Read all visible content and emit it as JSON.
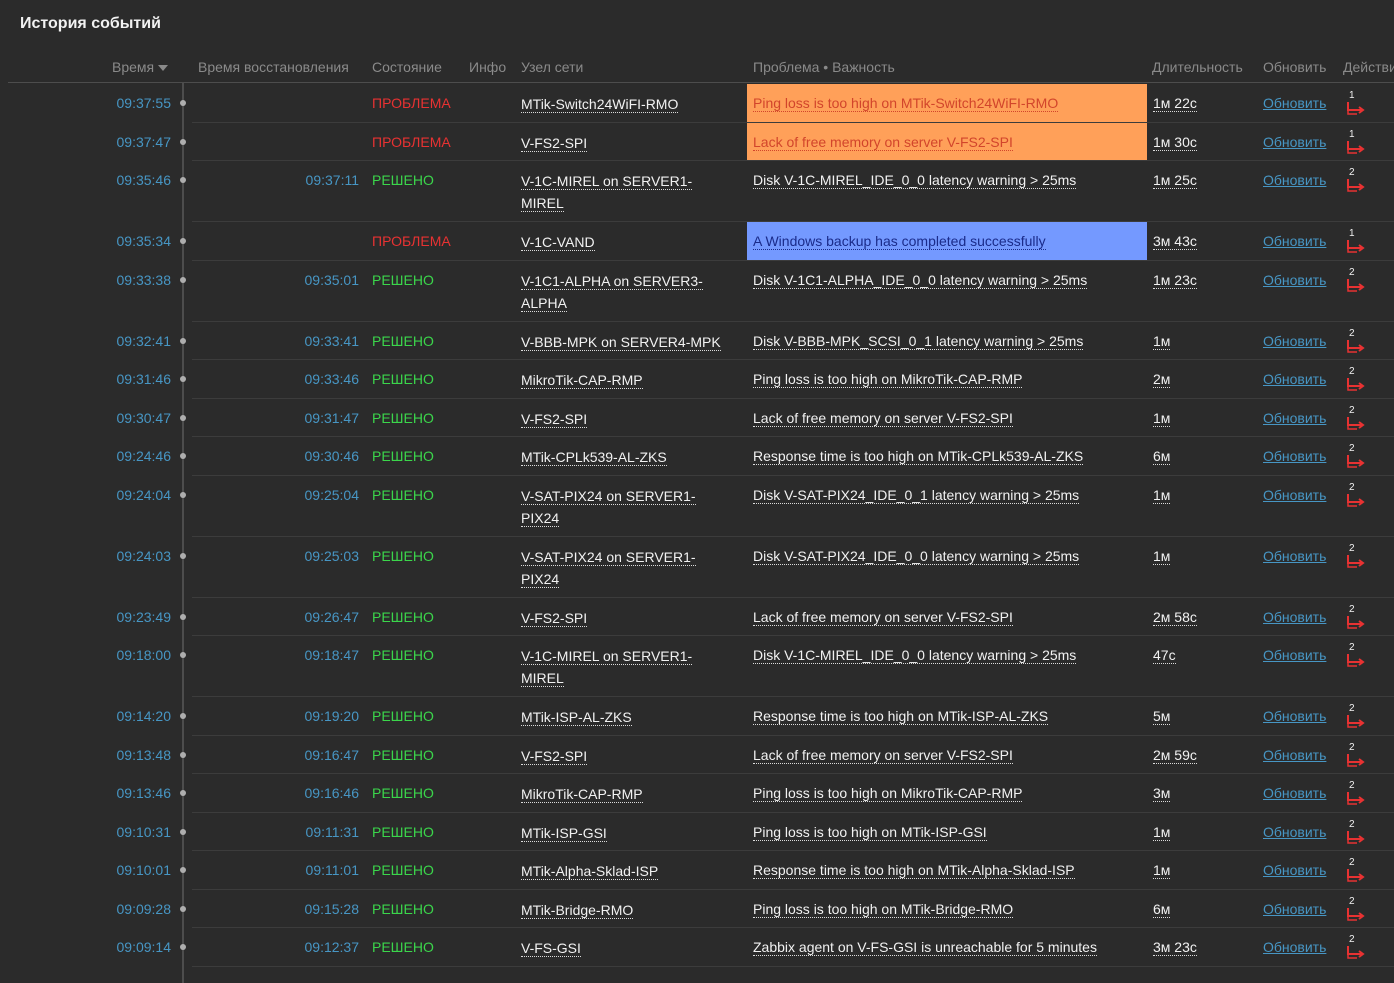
{
  "widget": {
    "title": "История событий"
  },
  "headers": {
    "time": "Время",
    "recovery": "Время восстановления",
    "status": "Состояние",
    "info": "Инфо",
    "host": "Узел сети",
    "problem": "Проблема • Важность",
    "duration": "Длительность",
    "ack": "Обновить",
    "actions": "Действия"
  },
  "rows": [
    {
      "time": "09:37:55",
      "recovery": "",
      "status": "ПРОБЛЕМА",
      "host": "MTik-Switch24WiFI-RMO",
      "problem": "Ping loss is too high on MTik-Switch24WiFI-RMO",
      "duration": "1м 22с",
      "ack": "Обновить",
      "actions": "1"
    },
    {
      "time": "09:37:47",
      "recovery": "",
      "status": "ПРОБЛЕМА",
      "host": "V-FS2-SPI",
      "problem": "Lack of free memory on server V-FS2-SPI",
      "duration": "1м 30с",
      "ack": "Обновить",
      "actions": "1"
    },
    {
      "time": "09:35:46",
      "recovery": "09:37:11",
      "status": "РЕШЕНО",
      "host": "V-1C-MIREL on SERVER1-MIREL",
      "problem": "Disk V-1C-MIREL_IDE_0_0 latency warning > 25ms",
      "duration": "1м 25с",
      "ack": "Обновить",
      "actions": "2"
    },
    {
      "time": "09:35:34",
      "recovery": "",
      "status": "ПРОБЛЕМА",
      "host": "V-1C-VAND",
      "problem": "A Windows backup has completed successfully",
      "duration": "3м 43с",
      "ack": "Обновить",
      "actions": "1"
    },
    {
      "time": "09:33:38",
      "recovery": "09:35:01",
      "status": "РЕШЕНО",
      "host": "V-1C1-ALPHA on SERVER3-ALPHA",
      "problem": "Disk V-1C1-ALPHA_IDE_0_0 latency warning > 25ms",
      "duration": "1м 23с",
      "ack": "Обновить",
      "actions": "2"
    },
    {
      "time": "09:32:41",
      "recovery": "09:33:41",
      "status": "РЕШЕНО",
      "host": "V-BBB-MPK on SERVER4-MPK",
      "problem": "Disk V-BBB-MPK_SCSI_0_1 latency warning > 25ms",
      "duration": "1м",
      "ack": "Обновить",
      "actions": "2"
    },
    {
      "time": "09:31:46",
      "recovery": "09:33:46",
      "status": "РЕШЕНО",
      "host": "MikroTik-CAP-RMP",
      "problem": "Ping loss is too high on MikroTik-CAP-RMP",
      "duration": "2м",
      "ack": "Обновить",
      "actions": "2"
    },
    {
      "time": "09:30:47",
      "recovery": "09:31:47",
      "status": "РЕШЕНО",
      "host": "V-FS2-SPI",
      "problem": "Lack of free memory on server V-FS2-SPI",
      "duration": "1м",
      "ack": "Обновить",
      "actions": "2"
    },
    {
      "time": "09:24:46",
      "recovery": "09:30:46",
      "status": "РЕШЕНО",
      "host": "MTik-CPLk539-AL-ZKS",
      "problem": "Response time is too high on MTik-CPLk539-AL-ZKS",
      "duration": "6м",
      "ack": "Обновить",
      "actions": "2"
    },
    {
      "time": "09:24:04",
      "recovery": "09:25:04",
      "status": "РЕШЕНО",
      "host": "V-SAT-PIX24 on SERVER1-PIX24",
      "problem": "Disk V-SAT-PIX24_IDE_0_1 latency warning > 25ms",
      "duration": "1м",
      "ack": "Обновить",
      "actions": "2"
    },
    {
      "time": "09:24:03",
      "recovery": "09:25:03",
      "status": "РЕШЕНО",
      "host": "V-SAT-PIX24 on SERVER1-PIX24",
      "problem": "Disk V-SAT-PIX24_IDE_0_0 latency warning > 25ms",
      "duration": "1м",
      "ack": "Обновить",
      "actions": "2"
    },
    {
      "time": "09:23:49",
      "recovery": "09:26:47",
      "status": "РЕШЕНО",
      "host": "V-FS2-SPI",
      "problem": "Lack of free memory on server V-FS2-SPI",
      "duration": "2м 58с",
      "ack": "Обновить",
      "actions": "2"
    },
    {
      "time": "09:18:00",
      "recovery": "09:18:47",
      "status": "РЕШЕНО",
      "host": "V-1C-MIREL on SERVER1-MIREL",
      "problem": "Disk V-1C-MIREL_IDE_0_0 latency warning > 25ms",
      "duration": "47с",
      "ack": "Обновить",
      "actions": "2"
    },
    {
      "time": "09:14:20",
      "recovery": "09:19:20",
      "status": "РЕШЕНО",
      "host": "MTik-ISP-AL-ZKS",
      "problem": "Response time is too high on MTik-ISP-AL-ZKS",
      "duration": "5м",
      "ack": "Обновить",
      "actions": "2"
    },
    {
      "time": "09:13:48",
      "recovery": "09:16:47",
      "status": "РЕШЕНО",
      "host": "V-FS2-SPI",
      "problem": "Lack of free memory on server V-FS2-SPI",
      "duration": "2м 59с",
      "ack": "Обновить",
      "actions": "2"
    },
    {
      "time": "09:13:46",
      "recovery": "09:16:46",
      "status": "РЕШЕНО",
      "host": "MikroTik-CAP-RMP",
      "problem": "Ping loss is too high on MikroTik-CAP-RMP",
      "duration": "3м",
      "ack": "Обновить",
      "actions": "2"
    },
    {
      "time": "09:10:31",
      "recovery": "09:11:31",
      "status": "РЕШЕНО",
      "host": "MTik-ISP-GSI",
      "problem": "Ping loss is too high on MTik-ISP-GSI",
      "duration": "1м",
      "ack": "Обновить",
      "actions": "2"
    },
    {
      "time": "09:10:01",
      "recovery": "09:11:01",
      "status": "РЕШЕНО",
      "host": "MTik-Alpha-Sklad-ISP",
      "problem": "Response time is too high on MTik-Alpha-Sklad-ISP",
      "duration": "1м",
      "ack": "Обновить",
      "actions": "2"
    },
    {
      "time": "09:09:28",
      "recovery": "09:15:28",
      "status": "РЕШЕНО",
      "host": "MTik-Bridge-RMO",
      "problem": "Ping loss is too high on MTik-Bridge-RMO",
      "duration": "6м",
      "ack": "Обновить",
      "actions": "2"
    },
    {
      "time": "09:09:14",
      "recovery": "09:12:37",
      "status": "РЕШЕНО",
      "host": "V-FS-GSI",
      "problem": "Zabbix agent on V-FS-GSI is unreachable for 5 minutes",
      "duration": "3м 23с",
      "ack": "Обновить",
      "actions": "2"
    }
  ],
  "colors": {
    "problem_status": "#e83232",
    "resolved_status": "#3bd64b",
    "link": "#4796c4",
    "severity_average": "#ffa059",
    "severity_information": "#7499ff",
    "action_arrow": "#e83232"
  }
}
